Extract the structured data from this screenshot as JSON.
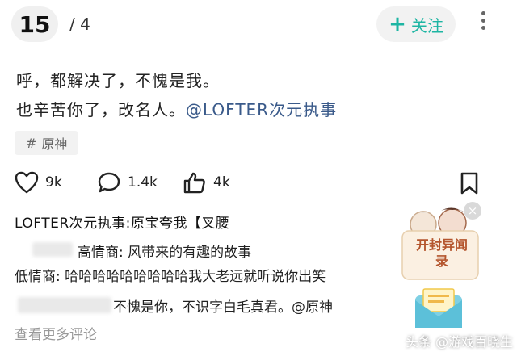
{
  "header": {
    "page_current": "15",
    "page_total": "/ 4",
    "follow_label": "关注",
    "follow_plus": "+"
  },
  "post": {
    "line1": "呼，都解决了，不愧是我。",
    "line2_text": "也辛苦你了，改名人。",
    "line2_mention": "@LOFTER次元执事",
    "tag": "原神",
    "tag_symbol": "#"
  },
  "actions": {
    "likes": "9k",
    "comments": "1.4k",
    "thumbs": "4k"
  },
  "comments": {
    "head": "LOFTER次元执事:原宝夸我【叉腰",
    "c1": "高情商: 风带来的有趣的故事",
    "c2": "低情商: 哈哈哈哈哈哈哈哈哈我大老远就听说你出笑",
    "c3": "不愧是你，不识字白毛真君。@原神",
    "view_more": "查看更多评论"
  },
  "ad": {
    "title": "开封异闻录",
    "close": "×"
  },
  "watermark": "头条 @游戏百晓生",
  "colors": {
    "accent": "#1db5a3",
    "mention": "#3a5a8a",
    "ad_title": "#b4552d"
  }
}
